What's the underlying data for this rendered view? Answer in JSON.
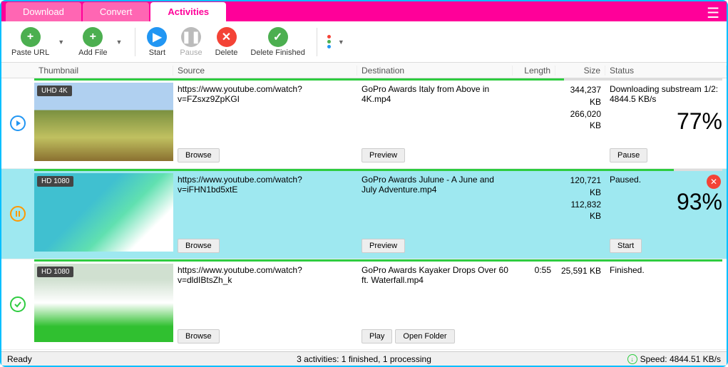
{
  "tabs": {
    "download": "Download",
    "convert": "Convert",
    "activities": "Activities"
  },
  "toolbar": {
    "paste_url": "Paste URL",
    "add_file": "Add File",
    "start": "Start",
    "pause": "Pause",
    "delete": "Delete",
    "delete_finished": "Delete Finished"
  },
  "columns": {
    "thumbnail": "Thumbnail",
    "source": "Source",
    "destination": "Destination",
    "length": "Length",
    "size": "Size",
    "status": "Status"
  },
  "rows": [
    {
      "state": "downloading",
      "badge": "UHD 4K",
      "source": "https://www.youtube.com/watch?v=FZsxz9ZpKGI",
      "destination": "GoPro Awards  Italy from Above in 4K.mp4",
      "length": "",
      "size1": "344,237 KB",
      "size2": "266,020 KB",
      "status_text": "Downloading substream 1/2: 4844.5 KB/s",
      "percent": "77%",
      "progress": 77,
      "btn_src": "Browse",
      "btn_dest": "Preview",
      "btn_status": "Pause"
    },
    {
      "state": "paused",
      "badge": "HD 1080",
      "source": "https://www.youtube.com/watch?v=iFHN1bd5xtE",
      "destination": "GoPro Awards  Julune - A June and July Adventure.mp4",
      "length": "",
      "size1": "120,721 KB",
      "size2": "112,832 KB",
      "status_text": "Paused.",
      "percent": "93%",
      "progress": 93,
      "btn_src": "Browse",
      "btn_dest": "Preview",
      "btn_status": "Start",
      "selected": true
    },
    {
      "state": "finished",
      "badge": "HD 1080",
      "source": "https://www.youtube.com/watch?v=dldIBtsZh_k",
      "destination": "GoPro Awards  Kayaker Drops Over 60 ft. Waterfall.mp4",
      "length": "0:55",
      "size1": "25,591 KB",
      "size2": "",
      "status_text": "Finished.",
      "percent": "",
      "progress": 100,
      "btn_src": "Browse",
      "btn_dest1": "Play",
      "btn_dest2": "Open Folder"
    }
  ],
  "statusbar": {
    "ready": "Ready",
    "activities": "3 activities: 1 finished, 1 processing",
    "speed": "Speed: 4844.51 KB/s"
  }
}
